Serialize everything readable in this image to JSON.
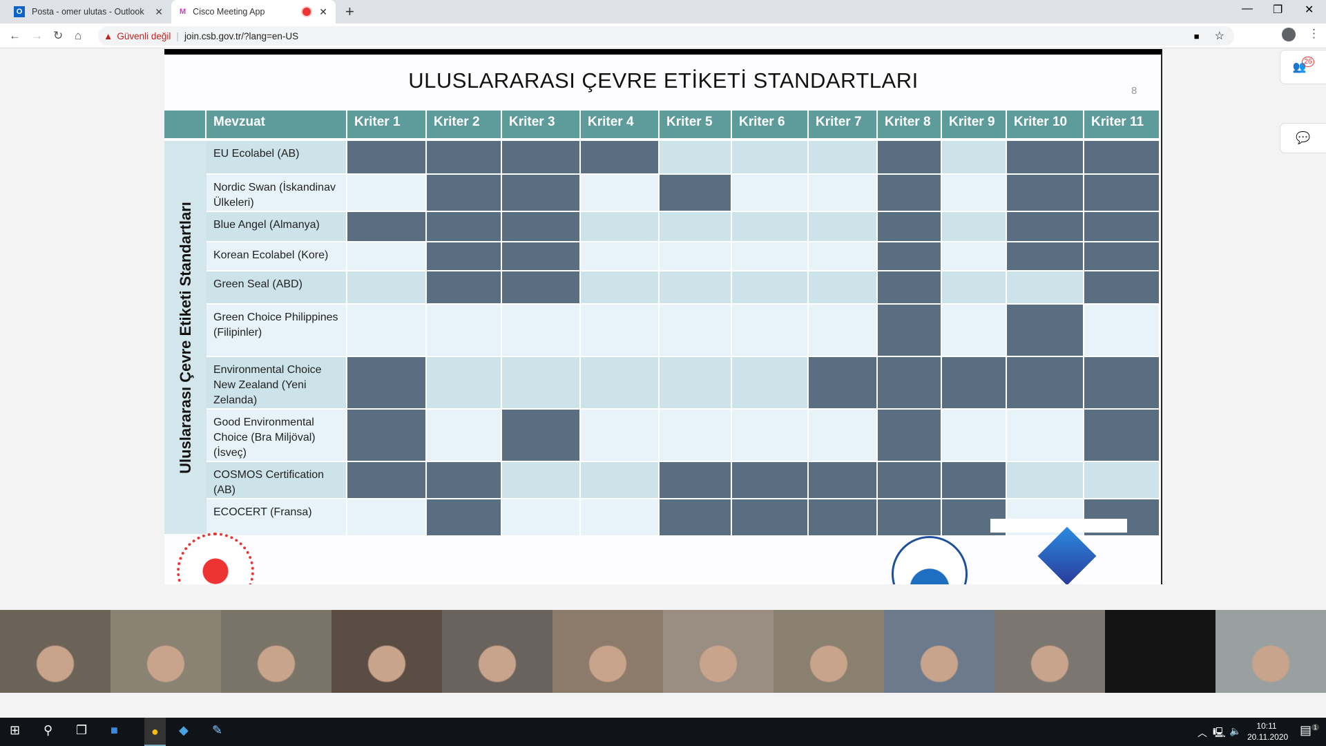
{
  "browser": {
    "tabs": [
      {
        "title": "Posta - omer ulutas - Outlook",
        "icon": "outlook-icon"
      },
      {
        "title": "Cisco Meeting App",
        "icon": "cisco-meeting-icon",
        "recording": true
      }
    ],
    "security_label": "Güvenli değil",
    "url": "join.csb.gov.tr/?lang=en-US"
  },
  "meeting": {
    "participants_count": "26"
  },
  "slide": {
    "title": "ULUSLARARASI ÇEVRE ETİKETİ STANDARTLARI",
    "page_number": "8",
    "side_label": "Uluslararası Çevre Etiketi Standartları",
    "header_first": "Mevzuat",
    "criteria": [
      "Kriter 1",
      "Kriter 2",
      "Kriter 3",
      "Kriter 4",
      "Kriter 5",
      "Kriter 6",
      "Kriter 7",
      "Kriter 8",
      "Kriter 9",
      "Kriter 10",
      "Kriter 11"
    ],
    "rows": [
      {
        "name": "EU Ecolabel (AB)",
        "marked": [
          1,
          2,
          3,
          4,
          8,
          10,
          11
        ]
      },
      {
        "name": "Nordic Swan (İskandinav Ülkeleri)",
        "marked": [
          2,
          3,
          5,
          8,
          10,
          11
        ]
      },
      {
        "name": "Blue Angel (Almanya)",
        "marked": [
          1,
          2,
          3,
          8,
          10,
          11
        ]
      },
      {
        "name": "Korean Ecolabel (Kore)",
        "marked": [
          2,
          3,
          8,
          10,
          11
        ]
      },
      {
        "name": "Green Seal (ABD)",
        "marked": [
          2,
          3,
          8,
          11
        ]
      },
      {
        "name": "Green Choice Philippines (Filipinler)",
        "marked": [
          8,
          10
        ]
      },
      {
        "name": "Environmental Choice New Zealand (Yeni Zelanda)",
        "marked": [
          1,
          7,
          8,
          9,
          10,
          11
        ]
      },
      {
        "name": "Good Environmental Choice (Bra Miljöval) (İsveç)",
        "marked": [
          1,
          3,
          8,
          11
        ]
      },
      {
        "name": "COSMOS Certification (AB)",
        "marked": [
          1,
          2,
          5,
          6,
          7,
          8,
          9
        ]
      },
      {
        "name": "ECOCERT (Fransa)",
        "marked": [
          2,
          5,
          6,
          7,
          8,
          9,
          11
        ]
      }
    ],
    "colors": {
      "marked": "#5a6e82",
      "header": "#5e9c9c",
      "row_dark": "#cde3ea",
      "row_light": "#e7f3f8"
    }
  },
  "taskbar": {
    "time": "10:11",
    "date": "20.11.2020",
    "notifications": "1"
  }
}
